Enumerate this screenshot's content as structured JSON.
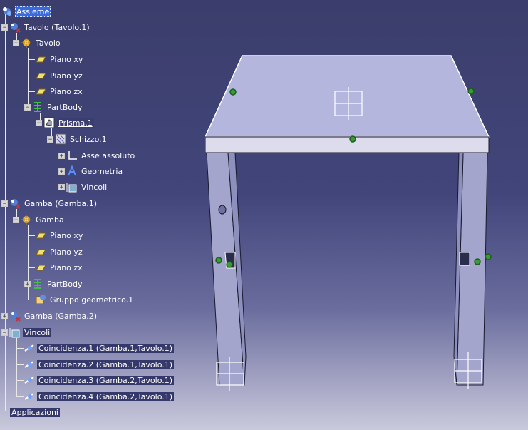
{
  "tree": {
    "root": "Assieme",
    "tavolo_product": "Tavolo (Tavolo.1)",
    "tavolo_part": "Tavolo",
    "piano_xy": "Piano xy",
    "piano_yz": "Piano yz",
    "piano_zx": "Piano zx",
    "partbody": "PartBody",
    "prisma": "Prisma.1",
    "schizzo": "Schizzo.1",
    "asse": "Asse assoluto",
    "geometria": "Geometria",
    "vincoli_sketch": "Vincoli",
    "gamba1_product": "Gamba (Gamba.1)",
    "gamba_part": "Gamba",
    "gruppo": "Gruppo geometrico.1",
    "gamba2_product": "Gamba (Gamba.2)",
    "vincoli": "Vincoli",
    "coinc1": "Coincidenza.1 (Gamba.1,Tavolo.1)",
    "coinc2": "Coincidenza.2 (Gamba.1,Tavolo.1)",
    "coinc3": "Coincidenza.3 (Gamba.2,Tavolo.1)",
    "coinc4": "Coincidenza.4 (Gamba.2,Tavolo.1)",
    "applicazioni": "Applicazioni"
  },
  "colors": {
    "background_top": "#3b3e6b",
    "background_bottom": "#c9c9dc",
    "table_top_face": "#b4b6de",
    "table_front_face": "#dcdcec",
    "leg_face": "#a5a7cf",
    "selection": "#3c6bd9",
    "constraint_marker": "#2e8b2e"
  }
}
